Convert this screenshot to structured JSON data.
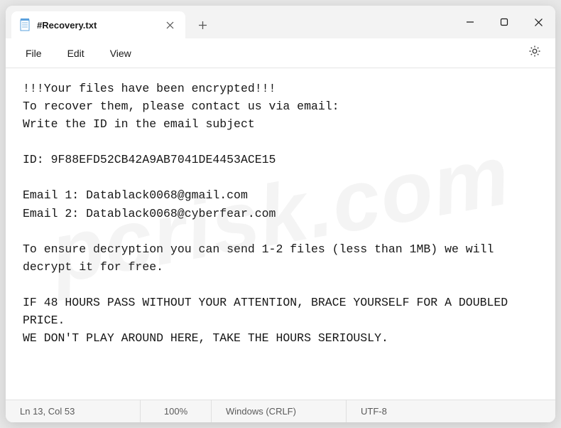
{
  "tab": {
    "title": "#Recovery.txt"
  },
  "menu": {
    "file": "File",
    "edit": "Edit",
    "view": "View"
  },
  "content": {
    "text": "!!!Your files have been encrypted!!!\nTo recover them, please contact us via email:\nWrite the ID in the email subject\n\nID: 9F88EFD52CB42A9AB7041DE4453ACE15\n\nEmail 1: Datablack0068@gmail.com\nEmail 2: Datablack0068@cyberfear.com\n\nTo ensure decryption you can send 1-2 files (less than 1MB) we will decrypt it for free.\n\nIF 48 HOURS PASS WITHOUT YOUR ATTENTION, BRACE YOURSELF FOR A DOUBLED PRICE.\nWE DON'T PLAY AROUND HERE, TAKE THE HOURS SERIOUSLY."
  },
  "status": {
    "cursor": "Ln 13, Col 53",
    "zoom": "100%",
    "line_ending": "Windows (CRLF)",
    "encoding": "UTF-8"
  },
  "watermark": "pcrisk.com"
}
